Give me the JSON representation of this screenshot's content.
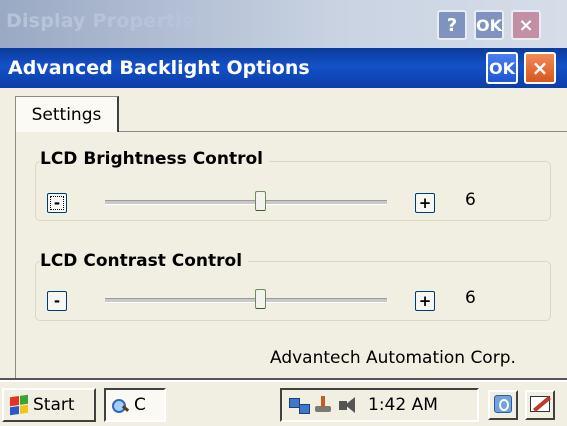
{
  "background_window": {
    "title": "Display Properties",
    "help_label": "?",
    "ok_label": "OK",
    "close_label": "×"
  },
  "dialog": {
    "title": "Advanced Backlight Options",
    "ok_label": "OK",
    "close_label": "×"
  },
  "tabs": [
    {
      "label": "Settings",
      "selected": true
    }
  ],
  "brightness": {
    "title": "LCD Brightness Control",
    "minus_label": "-",
    "plus_label": "+",
    "value": "6",
    "level_fraction": 0.55
  },
  "contrast": {
    "title": "LCD Contrast Control",
    "minus_label": "-",
    "plus_label": "+",
    "value": "6",
    "level_fraction": 0.55
  },
  "company": "Advantech Automation Corp.",
  "taskbar": {
    "start_label": "Start",
    "app_label": "C",
    "clock": "1:42 AM"
  },
  "colors": {
    "titlebar": "#1450c8",
    "dialog_bg": "#f1efe2",
    "close_button": "#d8561e"
  },
  "icons": [
    "help-icon",
    "close-icon",
    "windows-flag-icon",
    "network-icon",
    "usb-icon",
    "speaker-icon",
    "desktop-icon",
    "pen-icon"
  ]
}
